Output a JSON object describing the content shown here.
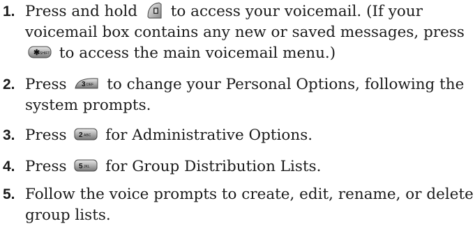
{
  "steps": [
    {
      "number": "1.",
      "parts": [
        "Press and hold",
        "to access your voicemail. (If your voicemail box contains any new or saved messages, press",
        "to access the main voicemail menu.)"
      ],
      "keys": [
        "voicemail-key",
        "star-shift-key"
      ]
    },
    {
      "number": "2.",
      "parts": [
        "Press",
        "to change your Personal Options, following the system prompts."
      ],
      "keys": [
        "3-def-key"
      ]
    },
    {
      "number": "3.",
      "parts": [
        "Press",
        "for Administrative Options."
      ],
      "keys": [
        "2-abc-key"
      ]
    },
    {
      "number": "4.",
      "parts": [
        "Press",
        "for Group Distribution Lists."
      ],
      "keys": [
        "5-jkl-key"
      ]
    },
    {
      "number": "5.",
      "parts": [
        "Follow the voice prompts to create, edit, rename, or delete group lists."
      ],
      "keys": []
    }
  ],
  "key_labels": {
    "star_shift": "* SHIFT",
    "three_def": "3 DEF",
    "two_abc": "2 ABC",
    "five_jkl": "5 JKL"
  }
}
